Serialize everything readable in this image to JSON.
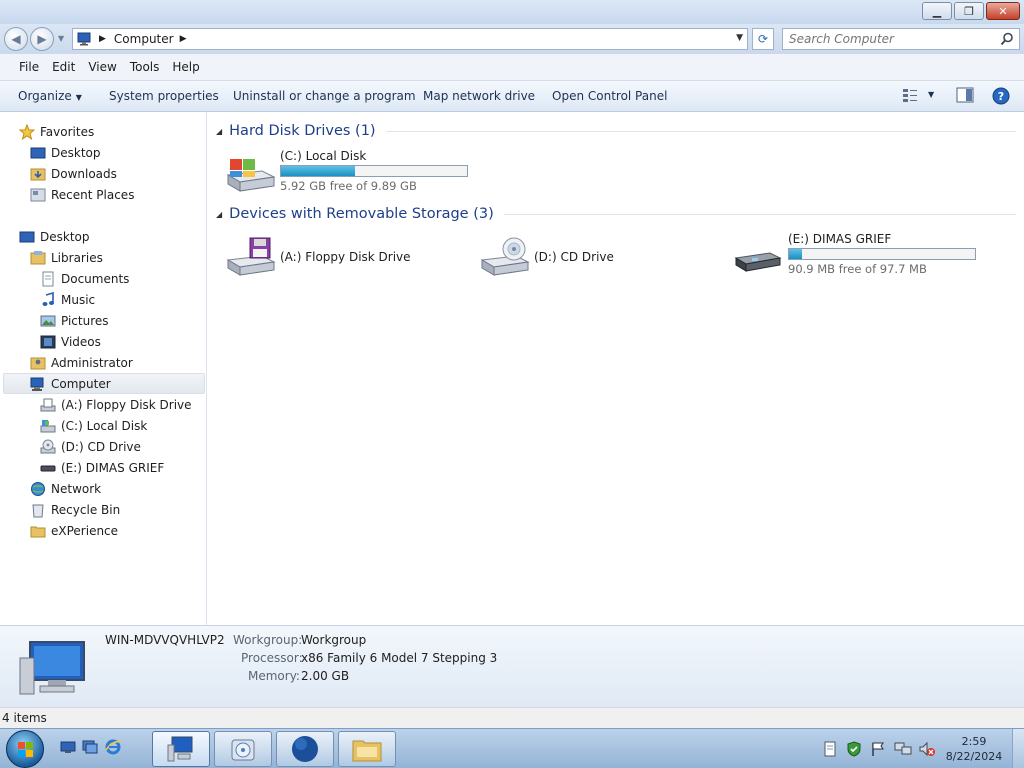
{
  "window": {
    "minimize_glyph": "▁",
    "restore_glyph": "❐",
    "close_glyph": "✕"
  },
  "address": {
    "crumb": "Computer",
    "search_placeholder": "Search Computer"
  },
  "menu": [
    "File",
    "Edit",
    "View",
    "Tools",
    "Help"
  ],
  "commands": {
    "organize": "Organize",
    "system_properties": "System properties",
    "uninstall": "Uninstall or change a program",
    "map_drive": "Map network drive",
    "control_panel": "Open Control Panel"
  },
  "nav": {
    "favorites": "Favorites",
    "fav_desktop": "Desktop",
    "fav_downloads": "Downloads",
    "fav_recent": "Recent Places",
    "desktop": "Desktop",
    "libraries": "Libraries",
    "documents": "Documents",
    "music": "Music",
    "pictures": "Pictures",
    "videos": "Videos",
    "administrator": "Administrator",
    "computer": "Computer",
    "floppy": "(A:) Floppy Disk Drive",
    "local_disk": "(C:) Local Disk",
    "cd": "(D:) CD Drive",
    "usb": "(E:) DIMAS GRIEF",
    "network": "Network",
    "recycle": "Recycle Bin",
    "experience": "eXPerience"
  },
  "groups": {
    "hdd": "Hard Disk Drives (1)",
    "removable": "Devices with Removable Storage (3)"
  },
  "drives": {
    "c": {
      "name": "(C:) Local Disk",
      "free": "5.92 GB free of 9.89 GB",
      "used_fraction": 0.4
    },
    "a": {
      "name": "(A:) Floppy Disk Drive"
    },
    "d": {
      "name": "(D:) CD Drive"
    },
    "e": {
      "name": "(E:) DIMAS GRIEF",
      "free": "90.9 MB free of 97.7 MB",
      "used_fraction": 0.07
    }
  },
  "details": {
    "computer_name": "WIN-MDVVQVHLVP2",
    "workgroup_label": "Workgroup:",
    "workgroup": "Workgroup",
    "processor_label": "Processor:",
    "processor": "x86 Family 6 Model 7 Stepping 3",
    "memory_label": "Memory:",
    "memory": "2.00 GB"
  },
  "status": {
    "items": "4 items"
  },
  "clock": {
    "time": "2:59",
    "date": "8/22/2024"
  },
  "colors": {
    "accent": "#1e3f8a",
    "bar_fill": "#1b8fc4"
  }
}
